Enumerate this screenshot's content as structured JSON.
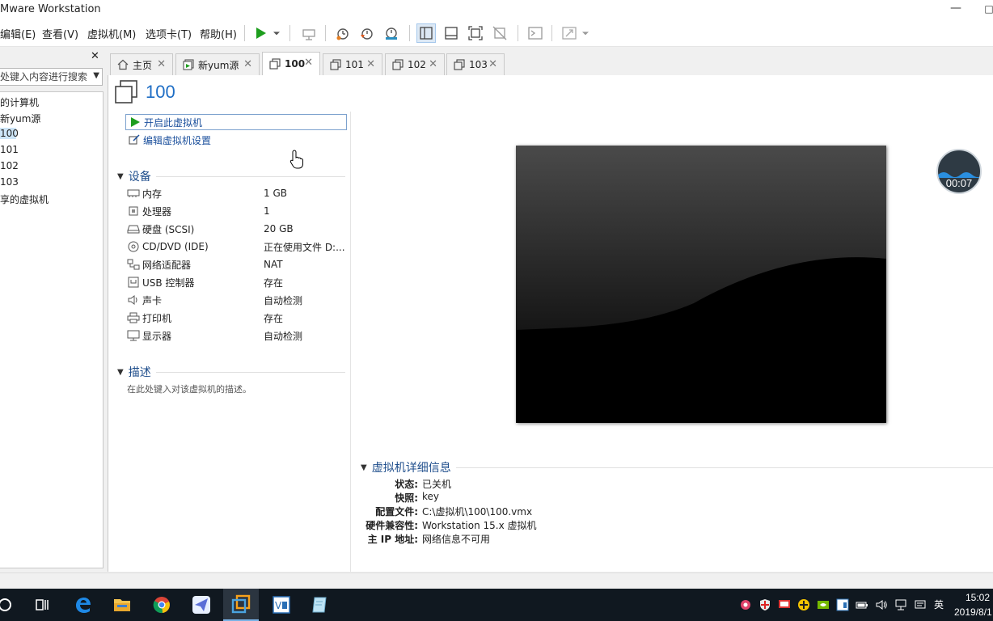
{
  "window": {
    "title": "Mware Workstation",
    "min_glyph": "—",
    "max_glyph": "□"
  },
  "menu": [
    "编辑(E)",
    "查看(V)",
    "虚拟机(M)",
    "选项卡(T)",
    "帮助(H)"
  ],
  "library": {
    "close_glyph": "✕",
    "search_placeholder": "处键入内容进行搜索",
    "items": [
      "的计算机",
      "新yum源",
      "100",
      "101",
      "102",
      "103",
      "享的虚拟机"
    ]
  },
  "tabs": [
    {
      "label": "主页",
      "icon": "home-icon"
    },
    {
      "label": "新yum源",
      "icon": "vm-running-icon"
    },
    {
      "label": "100",
      "icon": "vm-icon"
    },
    {
      "label": "101",
      "icon": "vm-icon"
    },
    {
      "label": "102",
      "icon": "vm-icon"
    },
    {
      "label": "103",
      "icon": "vm-icon"
    }
  ],
  "tab_close_glyph": "✕",
  "vm": {
    "title": "100",
    "actions": {
      "power_on": "开启此虚拟机",
      "edit_settings": "编辑虚拟机设置"
    },
    "devices_title": "设备",
    "devices": [
      {
        "name": "内存",
        "value": "1 GB",
        "icon": "memory-icon"
      },
      {
        "name": "处理器",
        "value": "1",
        "icon": "cpu-icon"
      },
      {
        "name": "硬盘 (SCSI)",
        "value": "20 GB",
        "icon": "disk-icon"
      },
      {
        "name": "CD/DVD (IDE)",
        "value": "正在使用文件 D:...",
        "icon": "cd-icon"
      },
      {
        "name": "网络适配器",
        "value": "NAT",
        "icon": "network-icon"
      },
      {
        "name": "USB 控制器",
        "value": "存在",
        "icon": "usb-icon"
      },
      {
        "name": "声卡",
        "value": "自动检测",
        "icon": "sound-icon"
      },
      {
        "name": "打印机",
        "value": "存在",
        "icon": "printer-icon"
      },
      {
        "name": "显示器",
        "value": "自动检测",
        "icon": "display-icon"
      }
    ],
    "description_title": "描述",
    "description_placeholder": "在此处键入对该虚拟机的描述。",
    "details_title": "虚拟机详细信息",
    "details": [
      {
        "key": "状态:",
        "value": "已关机"
      },
      {
        "key": "快照:",
        "value": "key"
      },
      {
        "key": "配置文件:",
        "value": "C:\\虚拟机\\100\\100.vmx"
      },
      {
        "key": "硬件兼容性:",
        "value": "Workstation 15.x 虚拟机"
      },
      {
        "key": "主 IP 地址:",
        "value": "网络信息不可用"
      }
    ]
  },
  "timer": {
    "time": "00:07"
  },
  "taskbar": {
    "ime": "英",
    "time": "15:02",
    "date": "2019/8/1"
  },
  "colors": {
    "accent": "#1f6ec5",
    "link": "#1a4f9c",
    "taskbar": "#101820",
    "play": "#1e9e1e"
  }
}
